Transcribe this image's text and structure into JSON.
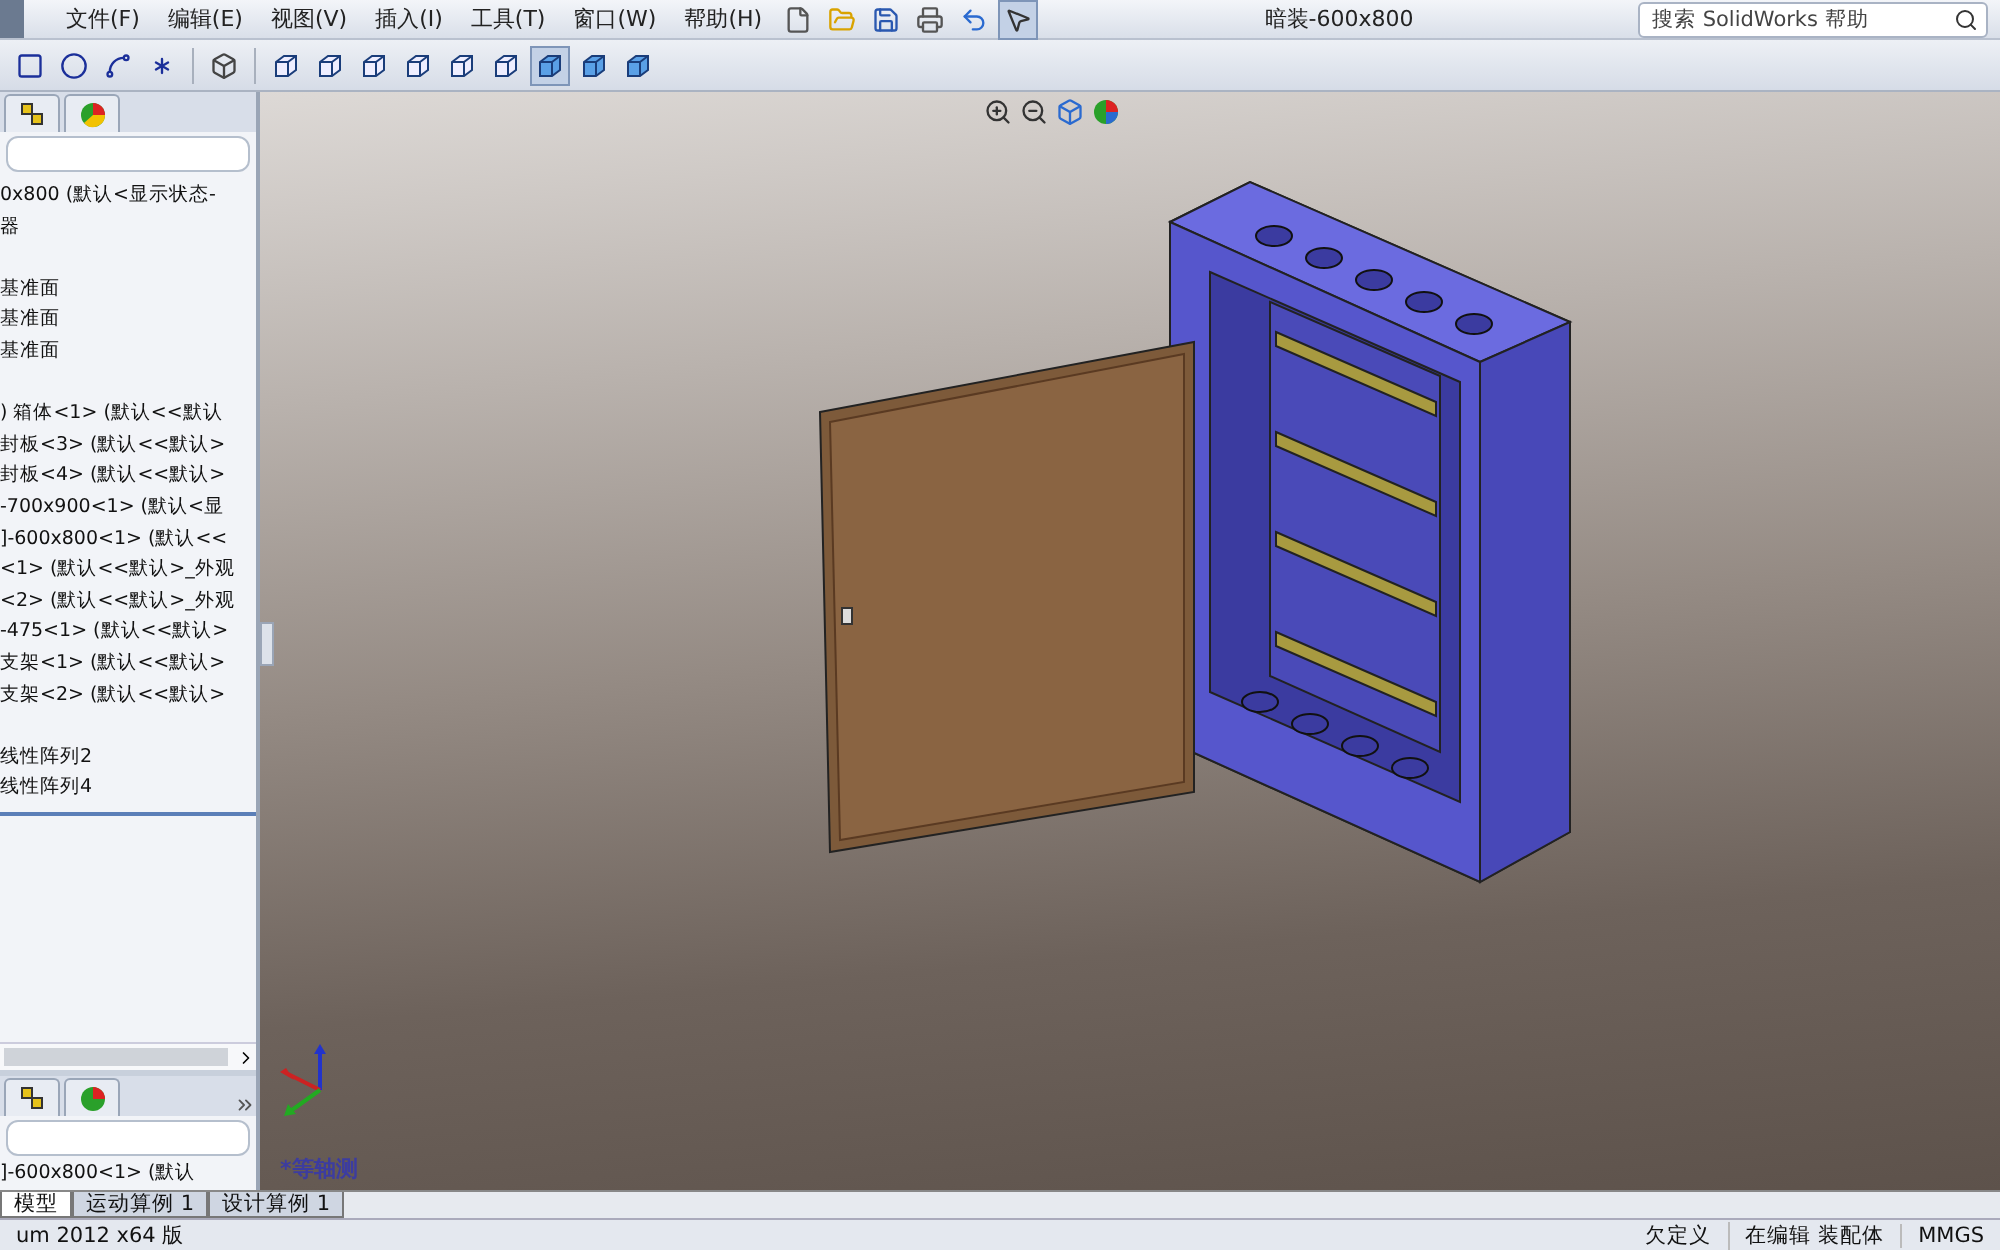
{
  "menu": [
    "文件(F)",
    "编辑(E)",
    "视图(V)",
    "插入(I)",
    "工具(T)",
    "窗口(W)",
    "帮助(H)"
  ],
  "window": {
    "title": "暗装-600x800"
  },
  "search": {
    "placeholder": "搜索 SolidWorks 帮助"
  },
  "view_modes": [
    {
      "selected": false
    },
    {
      "selected": false
    },
    {
      "selected": false
    },
    {
      "selected": false
    },
    {
      "selected": false
    },
    {
      "selected": false
    },
    {
      "selected": true
    },
    {
      "selected": false
    },
    {
      "selected": false
    }
  ],
  "tree": {
    "items": [
      {
        "label": "0x800  (默认<显示状态-",
        "gap_before": false
      },
      {
        "label": "器",
        "gap_before": false
      },
      {
        "label": "基准面",
        "gap_before": true
      },
      {
        "label": "基准面",
        "gap_before": false
      },
      {
        "label": "基准面",
        "gap_before": false
      },
      {
        "label": ") 箱体<1> (默认<<默认",
        "gap_before": true
      },
      {
        "label": "封板<3> (默认<<默认>",
        "gap_before": false
      },
      {
        "label": "封板<4> (默认<<默认>",
        "gap_before": false
      },
      {
        "label": "-700x900<1> (默认<显",
        "gap_before": false
      },
      {
        "label": "]-600x800<1> (默认<<",
        "gap_before": false
      },
      {
        "label": "<1> (默认<<默认>_外观",
        "gap_before": false
      },
      {
        "label": "<2> (默认<<默认>_外观",
        "gap_before": false
      },
      {
        "label": "-475<1> (默认<<默认>",
        "gap_before": false
      },
      {
        "label": "支架<1> (默认<<默认>",
        "gap_before": false
      },
      {
        "label": "支架<2> (默认<<默认>",
        "gap_before": false
      },
      {
        "label": "线性阵列2",
        "gap_before": true
      },
      {
        "label": "线性阵列4",
        "gap_before": false
      }
    ]
  },
  "lower_panel": {
    "partial_row": "]-600x800<1> (默认"
  },
  "viewport": {
    "view_label": "*等轴测"
  },
  "bottom_tabs": [
    {
      "label": "模型",
      "selected": true
    },
    {
      "label": "运动算例 1",
      "selected": false
    },
    {
      "label": "设计算例 1",
      "selected": false
    }
  ],
  "status_bar": {
    "version": "um 2012 x64 版",
    "state": "欠定义",
    "mode": "在编辑 装配体",
    "units": "MMGS"
  }
}
